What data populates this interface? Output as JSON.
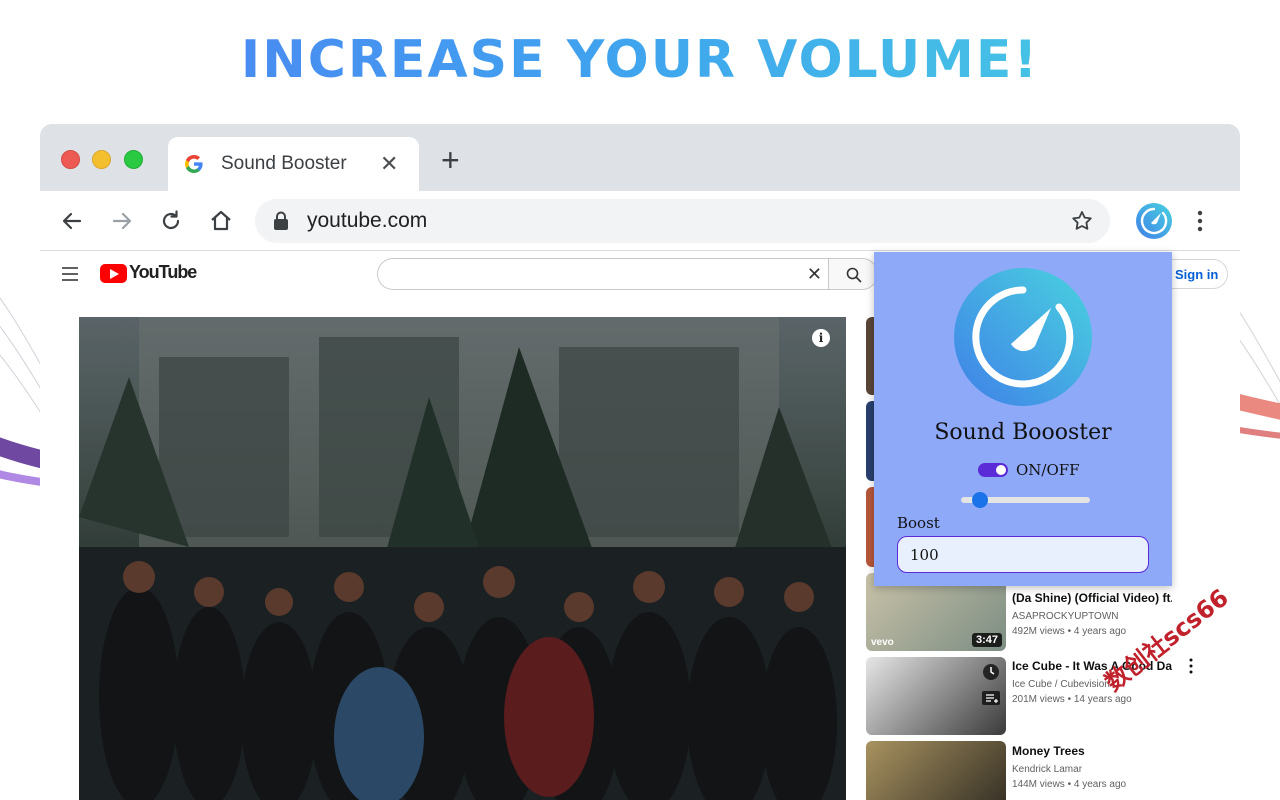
{
  "headline": "INCREASE YOUR VOLUME!",
  "colors": {
    "headline_start": "#4f7df3",
    "headline_end": "#49d3df",
    "popup_bg": "#8fa9f9",
    "toggle_on": "#5b2bd8",
    "youtube_red": "#ff0000"
  },
  "browser": {
    "tab": {
      "title": "Sound Booster",
      "favicon": "google-g-icon"
    },
    "address_bar": {
      "url": "youtube.com"
    }
  },
  "youtube": {
    "logo_text": "YouTube",
    "search": {
      "value": "",
      "placeholder": ""
    },
    "sign_in_label": "Sign in",
    "info_icon": "i",
    "sidebar_videos": [
      {
        "title": "(Da Shine) (Official Video) ft....",
        "channel": "ASAPROCKYUPTOWN",
        "meta": "492M views • 4 years ago",
        "duration": "3:47",
        "badge": "vevo"
      },
      {
        "title": "Ice Cube - It Was A Good Day",
        "channel": "Ice Cube / Cubevision",
        "meta": "201M views • 14 years ago"
      },
      {
        "title": "Money Trees",
        "channel": "Kendrick Lamar",
        "meta": "144M views • 4 years ago"
      }
    ]
  },
  "popup": {
    "title": "Sound Boooster",
    "toggle_label": "ON/OFF",
    "toggle_on": true,
    "slider_value_fraction": 0.15,
    "boost_label": "Boost",
    "boost_value": "100"
  },
  "watermark": "数创社scs66"
}
